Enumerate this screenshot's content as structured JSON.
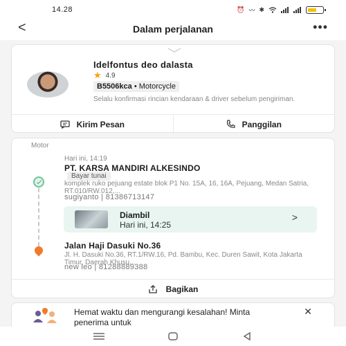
{
  "status_bar": {
    "time": "14.28"
  },
  "header": {
    "title": "Dalam perjalanan",
    "back_icon": "chevron-left-icon",
    "more_icon": "more-dots-icon"
  },
  "driver": {
    "name": "Idelfontus deo dalasta",
    "rating": "4.9",
    "plate": "B5506kca",
    "vehicle": "Motorcycle",
    "note": "Selalu konfirmasi rincian kendaraan & driver sebelum pengiriman."
  },
  "actions": {
    "message_label": "Kirim Pesan",
    "call_label": "Panggilan"
  },
  "trip": {
    "service": "Motor",
    "pickup": {
      "time": "Hari ini, 14:19",
      "name": "PT. KARSA MANDIRI ALKESINDO",
      "payment": "Bayar tunai",
      "address": "komplek ruko pejuang estate blok P1 No. 15A, 16, 16A, Pejuang, Medan Satria, RT.010/RW.012,...",
      "contact": "sugiyanto | 81386713147"
    },
    "status": {
      "title": "Diambil",
      "time": "Hari ini, 14:25"
    },
    "dropoff": {
      "name": "Jalan Haji Dasuki No.36",
      "address": "Jl. H. Dasuki No.36, RT.1/RW.16, Pd. Bambu, Kec. Duren Sawit, Kota Jakarta Timur, Daerah Khusu...",
      "contact": "new leo | 81288889388"
    },
    "share_label": "Bagikan"
  },
  "promo": {
    "text": "Hemat waktu dan mengurangi kesalahan! Minta penerima untuk"
  },
  "colors": {
    "accent_green": "#6cc49a",
    "pin_orange": "#f07a2c",
    "star": "#f5a400",
    "status_bg": "#e8f5f1"
  }
}
